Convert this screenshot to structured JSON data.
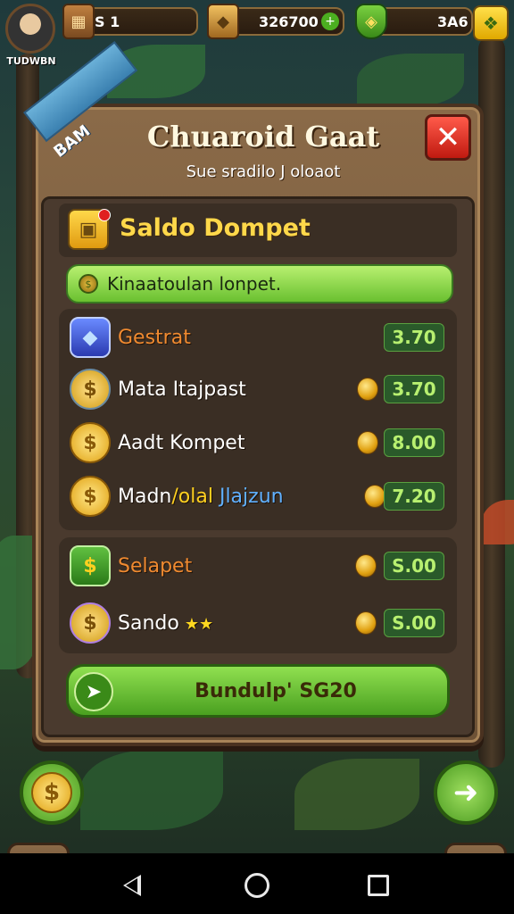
{
  "hud": {
    "player_name": "TUDWBN",
    "crates_value": "S 1",
    "gold_value": "326700",
    "gems_value": "3A6"
  },
  "panel": {
    "ribbon": "BAM",
    "title": "Chuaroid Gaat",
    "subtitle": "Sue sradilo J oloaot",
    "close_symbol": "✕"
  },
  "wallet": {
    "title": "Saldo Dompet",
    "banner": "Kinaatoulan lonpet.",
    "rows": [
      {
        "label": "Gestrat",
        "value": "3.70",
        "label_color": "#f08a30"
      },
      {
        "label": "Mata Itajpast",
        "value": "3.70",
        "label_color": "#ffffff"
      },
      {
        "label": "Aadt Kompet",
        "value": "8.00",
        "label_color": "#ffffff"
      },
      {
        "label_a": "Madn",
        "label_b": "/olal",
        "label_c": "Jlajzun",
        "value": "7.20"
      }
    ],
    "rows2": [
      {
        "label": "Selapet",
        "value": "S.00",
        "label_color": "#f08a30"
      },
      {
        "label": "Sando",
        "value": "S.00",
        "label_color": "#ffffff",
        "stars": "★★"
      }
    ]
  },
  "action": {
    "label": "Bundulp' SG20"
  }
}
